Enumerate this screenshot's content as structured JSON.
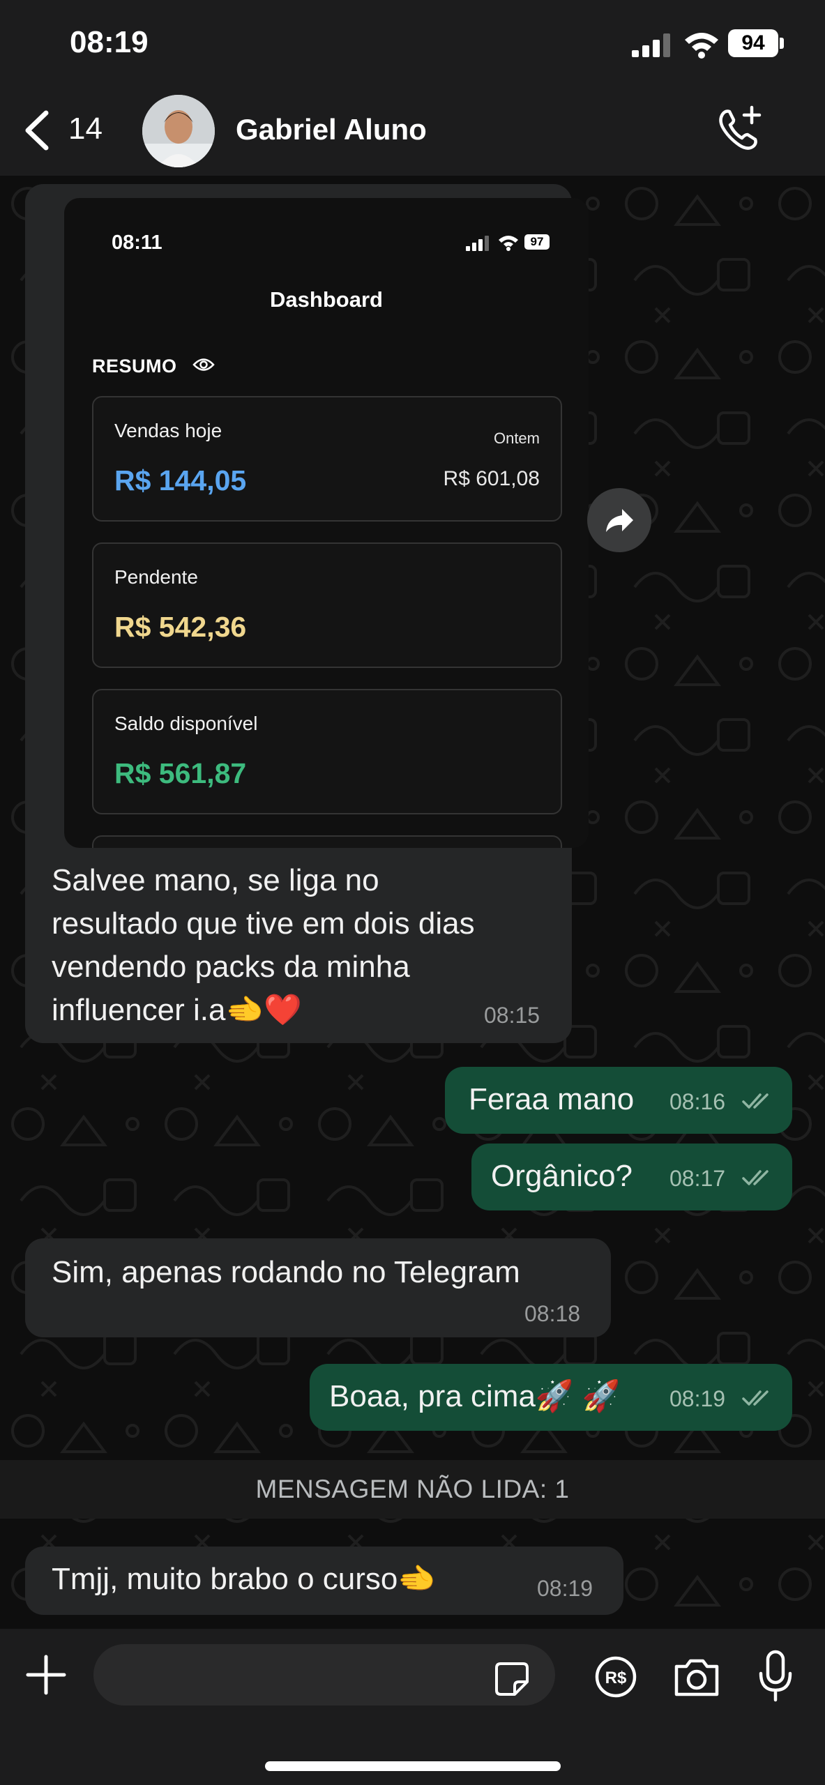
{
  "status_bar": {
    "time": "08:19",
    "battery": "94"
  },
  "header": {
    "back_count": "14",
    "contact_name": "Gabriel Aluno"
  },
  "shared_screenshot": {
    "status_time": "08:11",
    "status_battery": "97",
    "title": "Dashboard",
    "section_label": "RESUMO",
    "cards": [
      {
        "label": "Vendas hoje",
        "value": "R$ 144,05",
        "value_color": "#5aa5f0",
        "aside_label": "Ontem",
        "aside_value": "R$ 601,08"
      },
      {
        "label": "Pendente",
        "value": "R$ 542,36",
        "value_color": "#f0d78e"
      },
      {
        "label": "Saldo disponível",
        "value": "R$ 561,87",
        "value_color": "#3dbb7e"
      }
    ]
  },
  "messages": [
    {
      "direction": "in",
      "lines": [
        "Salvee mano, se liga no",
        "resultado que tive em dois dias",
        "vendendo packs da minha",
        "influencer i.a🫲❤️"
      ],
      "time": "08:15"
    },
    {
      "direction": "out",
      "text": "Feraa mano",
      "time": "08:16",
      "status": "read"
    },
    {
      "direction": "out",
      "text": "Orgânico?",
      "time": "08:17",
      "status": "read"
    },
    {
      "direction": "in",
      "text": "Sim, apenas rodando no Telegram",
      "time": "08:18"
    },
    {
      "direction": "out",
      "text": "Boaa, pra cima🚀 🚀",
      "time": "08:19",
      "status": "read"
    },
    {
      "direction": "in",
      "text": "Tmjj, muito brabo o curso🫲",
      "time": "08:19"
    }
  ],
  "unread_banner": "MENSAGEM NÃO LIDA: 1",
  "input_bar": {
    "placeholder": ""
  },
  "colors": {
    "incoming_bubble": "#252627",
    "outgoing_bubble": "#144d37",
    "read_ticks": "#8fb5a2"
  },
  "icons": [
    "back-chevron-icon",
    "call-add-icon",
    "forward-icon",
    "plus-icon",
    "sticker-icon",
    "payment-icon",
    "camera-icon",
    "microphone-icon"
  ]
}
